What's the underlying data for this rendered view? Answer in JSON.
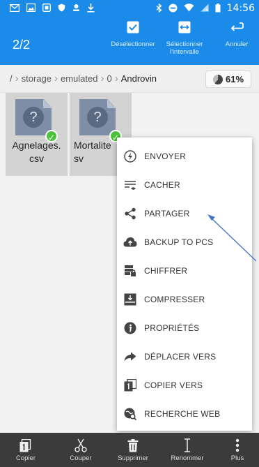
{
  "status_bar": {
    "time": "14:56",
    "left_icons": [
      "gmail-icon",
      "image-icon",
      "device-icon",
      "shield-icon",
      "face-icon",
      "download-icon"
    ],
    "right_icons": [
      "bluetooth-icon",
      "dnd-icon",
      "wifi-icon",
      "signal-icon",
      "battery-icon"
    ]
  },
  "action_bar": {
    "selection_count": "2/2",
    "deselect_label": "Désélectionner",
    "select_range_label": "Sélectionner l'intervalle",
    "cancel_label": "Annuler",
    "accent_color": "#1a8be8"
  },
  "breadcrumb": {
    "items": [
      "/",
      "storage",
      "emulated",
      "0",
      "Androvin"
    ],
    "storage_percent": "61%"
  },
  "files": [
    {
      "name": "Agnelages.\ncsv",
      "selected": true
    },
    {
      "name": "Mortalite\nsv",
      "selected": true
    }
  ],
  "context_menu": {
    "items": [
      {
        "label": "ENVOYER",
        "icon": "send-icon"
      },
      {
        "label": "CACHER",
        "icon": "hide-icon"
      },
      {
        "label": "PARTAGER",
        "icon": "share-icon"
      },
      {
        "label": "BACKUP TO PCS",
        "icon": "cloud-upload-icon"
      },
      {
        "label": "CHIFFRER",
        "icon": "encrypt-icon"
      },
      {
        "label": "COMPRESSER",
        "icon": "compress-icon"
      },
      {
        "label": "PROPRIÉTÉS",
        "icon": "info-icon"
      },
      {
        "label": "DÉPLACER VERS",
        "icon": "move-icon"
      },
      {
        "label": "COPIER VERS",
        "icon": "copy-to-icon"
      },
      {
        "label": "RECHERCHE WEB",
        "icon": "web-search-icon"
      }
    ]
  },
  "bottom_bar": {
    "copy_label": "Copier",
    "cut_label": "Couper",
    "delete_label": "Supprimer",
    "rename_label": "Renommer",
    "more_label": "Plus"
  }
}
